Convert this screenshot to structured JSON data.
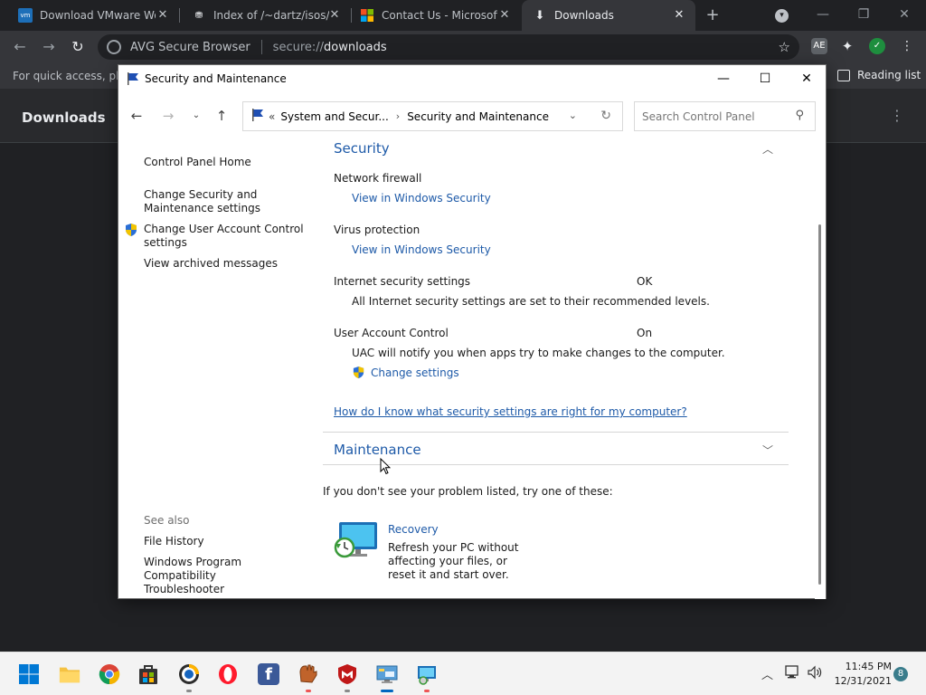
{
  "browser": {
    "tabs": [
      {
        "title": "Download VMware Wo",
        "favicon": "vmware-icon",
        "active": false
      },
      {
        "title": "Index of /~dartz/isos/",
        "favicon": "server-icon",
        "active": false
      },
      {
        "title": "Contact Us - Microsoft",
        "favicon": "microsoft-icon",
        "active": false
      },
      {
        "title": "Downloads",
        "favicon": "download-icon",
        "active": true
      }
    ],
    "omnibox": {
      "brand": "AVG Secure Browser",
      "url_scheme": "secure://",
      "url_host": "downloads"
    },
    "bookmark_hint": "For quick access, plac",
    "reading_list": "Reading list",
    "downloads_title": "Downloads",
    "extension_badge": "AE"
  },
  "control_panel": {
    "window_title": "Security and Maintenance",
    "address": {
      "prefix": "«",
      "crumb1": "System and Secur...",
      "crumb2": "Security and Maintenance"
    },
    "search_placeholder": "Search Control Panel",
    "left_nav": {
      "home": "Control Panel Home",
      "change_settings": "Change Security and Maintenance settings",
      "uac": "Change User Account Control settings",
      "archived": "View archived messages",
      "see_also": "See also",
      "file_history": "File History",
      "compat": "Windows Program Compatibility Troubleshooter"
    },
    "security": {
      "heading": "Security",
      "firewall_label": "Network firewall",
      "firewall_link": "View in Windows Security",
      "virus_label": "Virus protection",
      "virus_link": "View in Windows Security",
      "inet_label": "Internet security settings",
      "inet_value": "OK",
      "inet_desc": "All Internet security settings are set to their recommended levels.",
      "uac_label": "User Account Control",
      "uac_value": "On",
      "uac_desc": "UAC will notify you when apps try to make changes to the computer.",
      "uac_link": "Change settings",
      "help_link": "How do I know what security settings are right for my computer?"
    },
    "maintenance": {
      "heading": "Maintenance"
    },
    "problem_text": "If you don't see your problem listed, try one of these:",
    "recovery": {
      "title": "Recovery",
      "desc": "Refresh your PC without affecting your files, or reset it and start over."
    }
  },
  "taskbar": {
    "time": "11:45 PM",
    "date": "12/31/2021",
    "notifications": "8"
  },
  "colors": {
    "link": "#1e5aa8",
    "browser_bg": "#202124",
    "taskbar_bg": "#f3f3f3"
  }
}
